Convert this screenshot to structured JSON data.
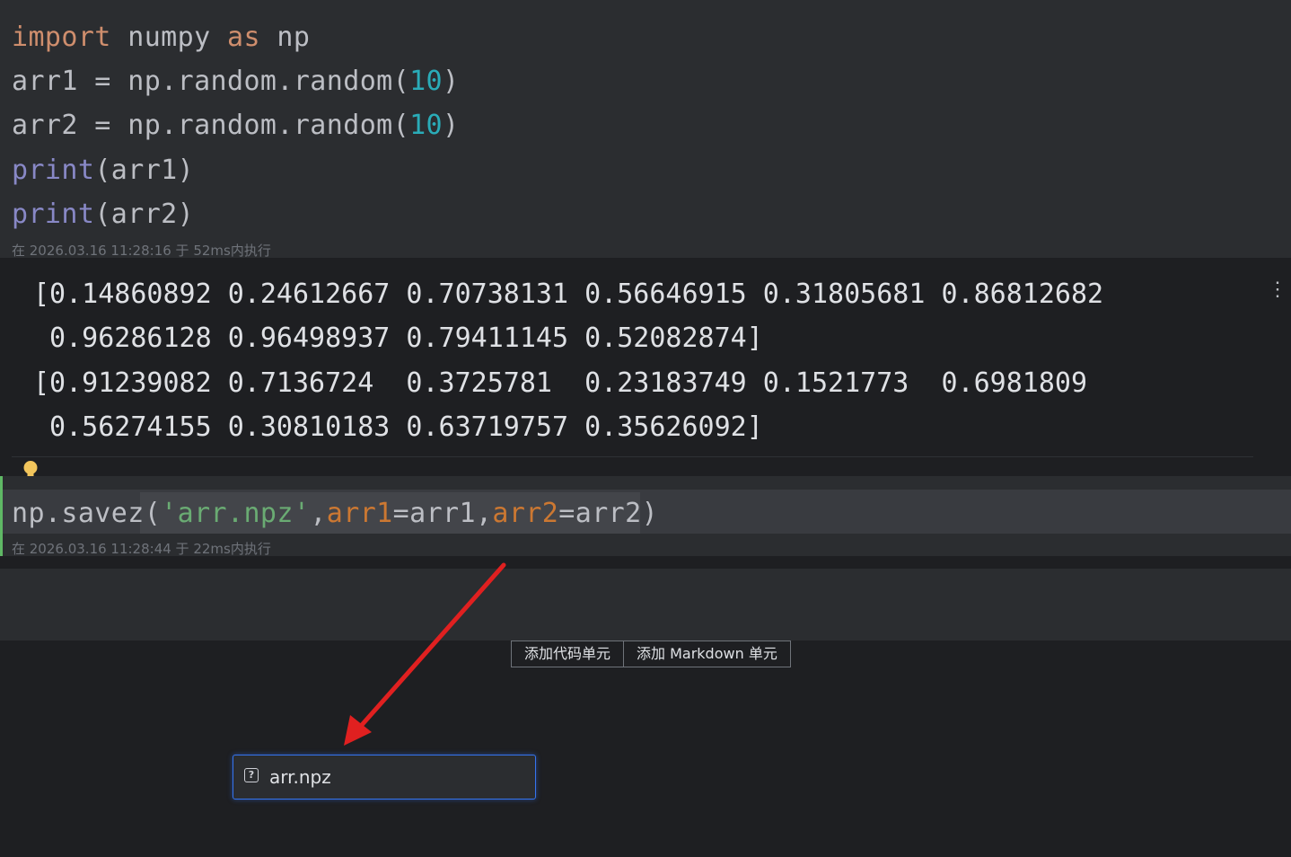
{
  "cell1": {
    "lines": [
      [
        {
          "t": "import",
          "c": "kw"
        },
        {
          "t": " numpy ",
          "c": ""
        },
        {
          "t": "as",
          "c": "kw"
        },
        {
          "t": " np",
          "c": ""
        }
      ],
      [
        {
          "t": "arr1 = np.random.random(",
          "c": ""
        },
        {
          "t": "10",
          "c": "num"
        },
        {
          "t": ")",
          "c": ""
        }
      ],
      [
        {
          "t": "arr2 = np.random.random(",
          "c": ""
        },
        {
          "t": "10",
          "c": "num"
        },
        {
          "t": ")",
          "c": ""
        }
      ],
      [
        {
          "t": "print",
          "c": "builtin"
        },
        {
          "t": "(arr1)",
          "c": ""
        }
      ],
      [
        {
          "t": "print",
          "c": "builtin"
        },
        {
          "t": "(arr2)",
          "c": ""
        }
      ]
    ],
    "exec_info": "在 2026.03.16 11:28:16 于 52ms内执行"
  },
  "output1": {
    "lines": [
      "[0.14860892 0.24612667 0.70738131 0.56646915 0.31805681 0.86812682",
      " 0.96286128 0.96498937 0.79411145 0.52082874]",
      "[0.91239082 0.7136724  0.3725781  0.23183749 0.1521773  0.6981809",
      " 0.56274155 0.30810183 0.63719757 0.35626092]"
    ],
    "menu_glyph": "⋮"
  },
  "cell2": {
    "lines": [
      [
        {
          "t": "np.savez(",
          "c": ""
        },
        {
          "t": "'arr.npz'",
          "c": "str"
        },
        {
          "t": ",",
          "c": ""
        },
        {
          "t": "arr1",
          "c": "param"
        },
        {
          "t": "=arr1,",
          "c": ""
        },
        {
          "t": "arr2",
          "c": "param"
        },
        {
          "t": "=arr2)",
          "c": ""
        }
      ]
    ],
    "exec_info": "在 2026.03.16 11:28:44 于 22ms内执行"
  },
  "add_bar": {
    "code_label": "添加代码单元",
    "markdown_label": "添加 Markdown 单元"
  },
  "popup": {
    "file_icon": "unknown-file-icon",
    "file_icon_glyph": "?",
    "file_name": "arr.npz"
  },
  "colors": {
    "keyword": "#cf8e6d",
    "number": "#2aacb8",
    "builtin": "#8888c6",
    "string": "#6aab73",
    "param": "#cc7832",
    "active_bar": "#5fb865",
    "arrow": "#e02020",
    "popup_border": "#3574f0"
  }
}
